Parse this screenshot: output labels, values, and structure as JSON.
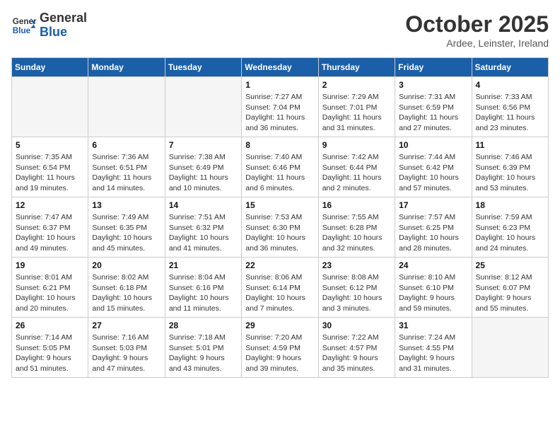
{
  "logo": {
    "line1": "General",
    "line2": "Blue"
  },
  "title": "October 2025",
  "subtitle": "Ardee, Leinster, Ireland",
  "days_of_week": [
    "Sunday",
    "Monday",
    "Tuesday",
    "Wednesday",
    "Thursday",
    "Friday",
    "Saturday"
  ],
  "weeks": [
    [
      {
        "day": "",
        "info": ""
      },
      {
        "day": "",
        "info": ""
      },
      {
        "day": "",
        "info": ""
      },
      {
        "day": "1",
        "info": "Sunrise: 7:27 AM\nSunset: 7:04 PM\nDaylight: 11 hours and 36 minutes."
      },
      {
        "day": "2",
        "info": "Sunrise: 7:29 AM\nSunset: 7:01 PM\nDaylight: 11 hours and 31 minutes."
      },
      {
        "day": "3",
        "info": "Sunrise: 7:31 AM\nSunset: 6:59 PM\nDaylight: 11 hours and 27 minutes."
      },
      {
        "day": "4",
        "info": "Sunrise: 7:33 AM\nSunset: 6:56 PM\nDaylight: 11 hours and 23 minutes."
      }
    ],
    [
      {
        "day": "5",
        "info": "Sunrise: 7:35 AM\nSunset: 6:54 PM\nDaylight: 11 hours and 19 minutes."
      },
      {
        "day": "6",
        "info": "Sunrise: 7:36 AM\nSunset: 6:51 PM\nDaylight: 11 hours and 14 minutes."
      },
      {
        "day": "7",
        "info": "Sunrise: 7:38 AM\nSunset: 6:49 PM\nDaylight: 11 hours and 10 minutes."
      },
      {
        "day": "8",
        "info": "Sunrise: 7:40 AM\nSunset: 6:46 PM\nDaylight: 11 hours and 6 minutes."
      },
      {
        "day": "9",
        "info": "Sunrise: 7:42 AM\nSunset: 6:44 PM\nDaylight: 11 hours and 2 minutes."
      },
      {
        "day": "10",
        "info": "Sunrise: 7:44 AM\nSunset: 6:42 PM\nDaylight: 10 hours and 57 minutes."
      },
      {
        "day": "11",
        "info": "Sunrise: 7:46 AM\nSunset: 6:39 PM\nDaylight: 10 hours and 53 minutes."
      }
    ],
    [
      {
        "day": "12",
        "info": "Sunrise: 7:47 AM\nSunset: 6:37 PM\nDaylight: 10 hours and 49 minutes."
      },
      {
        "day": "13",
        "info": "Sunrise: 7:49 AM\nSunset: 6:35 PM\nDaylight: 10 hours and 45 minutes."
      },
      {
        "day": "14",
        "info": "Sunrise: 7:51 AM\nSunset: 6:32 PM\nDaylight: 10 hours and 41 minutes."
      },
      {
        "day": "15",
        "info": "Sunrise: 7:53 AM\nSunset: 6:30 PM\nDaylight: 10 hours and 36 minutes."
      },
      {
        "day": "16",
        "info": "Sunrise: 7:55 AM\nSunset: 6:28 PM\nDaylight: 10 hours and 32 minutes."
      },
      {
        "day": "17",
        "info": "Sunrise: 7:57 AM\nSunset: 6:25 PM\nDaylight: 10 hours and 28 minutes."
      },
      {
        "day": "18",
        "info": "Sunrise: 7:59 AM\nSunset: 6:23 PM\nDaylight: 10 hours and 24 minutes."
      }
    ],
    [
      {
        "day": "19",
        "info": "Sunrise: 8:01 AM\nSunset: 6:21 PM\nDaylight: 10 hours and 20 minutes."
      },
      {
        "day": "20",
        "info": "Sunrise: 8:02 AM\nSunset: 6:18 PM\nDaylight: 10 hours and 15 minutes."
      },
      {
        "day": "21",
        "info": "Sunrise: 8:04 AM\nSunset: 6:16 PM\nDaylight: 10 hours and 11 minutes."
      },
      {
        "day": "22",
        "info": "Sunrise: 8:06 AM\nSunset: 6:14 PM\nDaylight: 10 hours and 7 minutes."
      },
      {
        "day": "23",
        "info": "Sunrise: 8:08 AM\nSunset: 6:12 PM\nDaylight: 10 hours and 3 minutes."
      },
      {
        "day": "24",
        "info": "Sunrise: 8:10 AM\nSunset: 6:10 PM\nDaylight: 9 hours and 59 minutes."
      },
      {
        "day": "25",
        "info": "Sunrise: 8:12 AM\nSunset: 6:07 PM\nDaylight: 9 hours and 55 minutes."
      }
    ],
    [
      {
        "day": "26",
        "info": "Sunrise: 7:14 AM\nSunset: 5:05 PM\nDaylight: 9 hours and 51 minutes."
      },
      {
        "day": "27",
        "info": "Sunrise: 7:16 AM\nSunset: 5:03 PM\nDaylight: 9 hours and 47 minutes."
      },
      {
        "day": "28",
        "info": "Sunrise: 7:18 AM\nSunset: 5:01 PM\nDaylight: 9 hours and 43 minutes."
      },
      {
        "day": "29",
        "info": "Sunrise: 7:20 AM\nSunset: 4:59 PM\nDaylight: 9 hours and 39 minutes."
      },
      {
        "day": "30",
        "info": "Sunrise: 7:22 AM\nSunset: 4:57 PM\nDaylight: 9 hours and 35 minutes."
      },
      {
        "day": "31",
        "info": "Sunrise: 7:24 AM\nSunset: 4:55 PM\nDaylight: 9 hours and 31 minutes."
      },
      {
        "day": "",
        "info": ""
      }
    ]
  ]
}
